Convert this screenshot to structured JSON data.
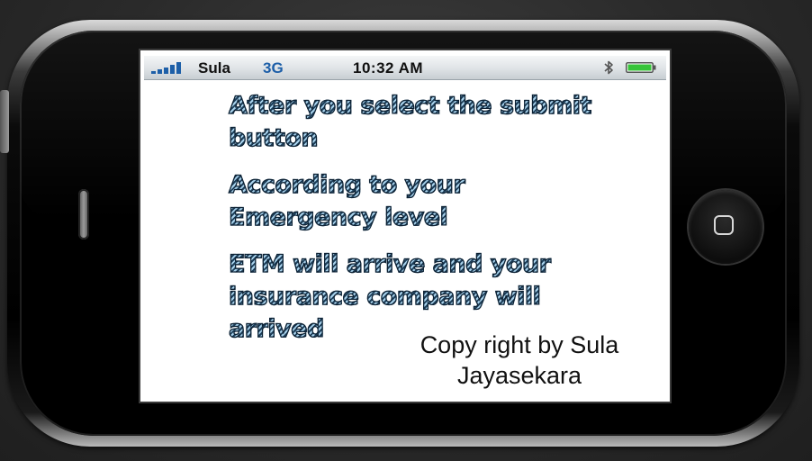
{
  "status_bar": {
    "carrier": "Sula",
    "network": "3G",
    "time": "10:32 AM",
    "signal_bars": 5,
    "battery_level": 1.0,
    "icons": [
      "signal-bars-icon",
      "bluetooth-icon",
      "battery-icon"
    ],
    "colors": {
      "network": "#1d5fa8",
      "battery": "#37c43a"
    }
  },
  "message": {
    "paragraphs": [
      {
        "line1": "After you select the submit",
        "line2": "button",
        "line3": ""
      },
      {
        "line1": "According to your",
        "line2": "Emergency level",
        "line3": ""
      },
      {
        "line1": "ETM will arrive and your",
        "line2": "insurance company will",
        "line3": "arrived"
      }
    ]
  },
  "copyright": {
    "line1": "Copy right by Sula",
    "line2": "Jayasekara"
  }
}
